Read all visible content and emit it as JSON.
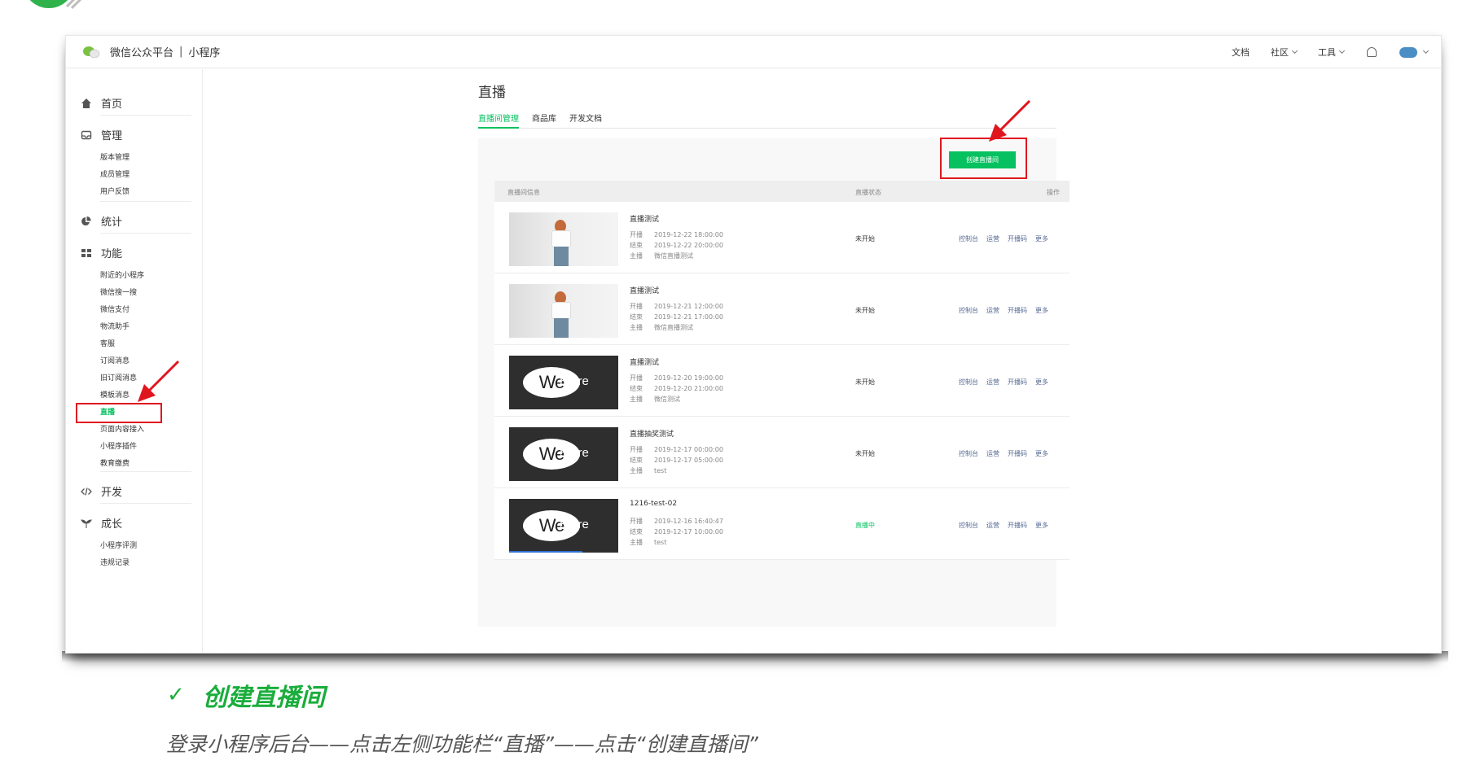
{
  "colors": {
    "accent": "#07c160",
    "highlight": "#e0161f",
    "link": "#576b95",
    "caption_green": "#1aad3c"
  },
  "header": {
    "brand": "微信公众平台",
    "separator": "|",
    "product": "小程序",
    "nav": [
      "文档",
      "社区",
      "工具"
    ]
  },
  "sidebar": {
    "sections": [
      {
        "label": "首页",
        "icon": "home-icon"
      },
      {
        "label": "管理",
        "icon": "inbox-icon",
        "items": [
          "版本管理",
          "成员管理",
          "用户反馈"
        ]
      },
      {
        "label": "统计",
        "icon": "pie-chart-icon"
      },
      {
        "label": "功能",
        "icon": "grid-icon",
        "items": [
          "附近的小程序",
          "微信搜一搜",
          "微信支付",
          "物流助手",
          "客服",
          "订阅消息",
          "旧订阅消息",
          "模板消息",
          "直播",
          "页面内容接入",
          "小程序插件",
          "教育缴费"
        ]
      },
      {
        "label": "开发",
        "icon": "code-icon"
      },
      {
        "label": "成长",
        "icon": "sprout-icon",
        "items": [
          "小程序评测",
          "违规记录"
        ]
      }
    ],
    "active_item": "直播"
  },
  "main": {
    "title": "直播",
    "tabs": [
      "直播间管理",
      "商品库",
      "开发文档"
    ],
    "create_button": "创建直播间",
    "table_headers": [
      "直播间信息",
      "直播状态",
      "操作"
    ],
    "meta_labels": [
      "开播",
      "结束",
      "主播"
    ],
    "ops": [
      "控制台",
      "运营",
      "开播码",
      "更多"
    ],
    "rows": [
      {
        "name": "直播测试",
        "start": "2019-12-22 18:00:00",
        "end": "2019-12-22 20:00:00",
        "host": "微信直播测试",
        "status": "未开始",
        "thumb": "photo"
      },
      {
        "name": "直播测试",
        "start": "2019-12-21 12:00:00",
        "end": "2019-12-21 17:00:00",
        "host": "微信直播测试",
        "status": "未开始",
        "thumb": "photo"
      },
      {
        "name": "直播测试",
        "start": "2019-12-20 19:00:00",
        "end": "2019-12-20 21:00:00",
        "host": "微信测试",
        "status": "未开始",
        "thumb": "store"
      },
      {
        "name": "直播抽奖测试",
        "start": "2019-12-17 00:00:00",
        "end": "2019-12-17 05:00:00",
        "host": "test",
        "status": "未开始",
        "thumb": "store"
      },
      {
        "name": "1216-test-02",
        "start": "2019-12-16 16:40:47",
        "end": "2019-12-17 10:00:00",
        "host": "test",
        "status": "直播中",
        "thumb": "store"
      }
    ],
    "store_logo": {
      "we": "We",
      "store": "Store"
    }
  },
  "caption": {
    "check": "✓",
    "title": "创建直播间",
    "text": "登录小程序后台——点击左侧功能栏“直播”——点击“创建直播间”"
  }
}
